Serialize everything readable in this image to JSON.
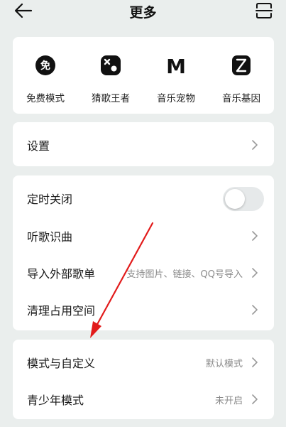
{
  "header": {
    "title": "更多"
  },
  "quick_items": [
    {
      "label": "免费模式",
      "icon": "free-mode-icon",
      "glyph": "免"
    },
    {
      "label": "猜歌王者",
      "icon": "game-controller-icon"
    },
    {
      "label": "音乐宠物",
      "icon": "music-pet-icon",
      "glyph": "M"
    },
    {
      "label": "音乐基因",
      "icon": "music-gene-icon"
    }
  ],
  "settings": {
    "label": "设置"
  },
  "tools": {
    "timer_label": "定时关闭",
    "timer_on": false,
    "recognize_label": "听歌识曲",
    "import_label": "导入外部歌单",
    "import_value": "支持图片、链接、QQ号导入",
    "clean_label": "清理占用空间"
  },
  "modes": {
    "mode_label": "模式与自定义",
    "mode_value": "默认模式",
    "teen_label": "青少年模式",
    "teen_value": "未开启"
  },
  "colors": {
    "background": "#eaeeed",
    "card": "#ffffff",
    "annotation_arrow": "#e21b1b"
  }
}
